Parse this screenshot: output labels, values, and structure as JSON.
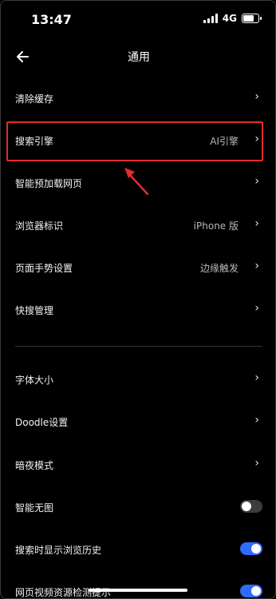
{
  "status": {
    "time": "13:47",
    "network": "4G",
    "signal_bars": 4,
    "battery_level": 0.8
  },
  "header": {
    "title": "通用",
    "back_icon": "back-arrow-icon"
  },
  "settings": [
    {
      "label": "清除缓存",
      "value": "",
      "control": "chevron"
    },
    {
      "label": "搜索引擎",
      "value": "AI引擎",
      "control": "chevron"
    },
    {
      "label": "智能预加载网页",
      "value": "",
      "control": "chevron"
    },
    {
      "label": "浏览器标识",
      "value": "iPhone 版",
      "control": "chevron"
    },
    {
      "label": "页面手势设置",
      "value": "边缘触发",
      "control": "chevron"
    },
    {
      "label": "快搜管理",
      "value": "",
      "control": "chevron"
    },
    {
      "label": "字体大小",
      "value": "",
      "control": "chevron"
    },
    {
      "label": "Doodle设置",
      "value": "",
      "control": "chevron"
    },
    {
      "label": "暗夜模式",
      "value": "",
      "control": "chevron"
    },
    {
      "label": "智能无图",
      "value": "",
      "control": "toggle",
      "state": false
    },
    {
      "label": "搜索时显示浏览历史",
      "value": "",
      "control": "toggle",
      "state": true
    },
    {
      "label": "网页视频资源检测提示",
      "value": "",
      "control": "toggle",
      "state": true
    }
  ],
  "chevron_glyph": "›",
  "colors": {
    "background": "#000000",
    "accent": "#2f6bff",
    "annotation": "#e52b2b"
  }
}
